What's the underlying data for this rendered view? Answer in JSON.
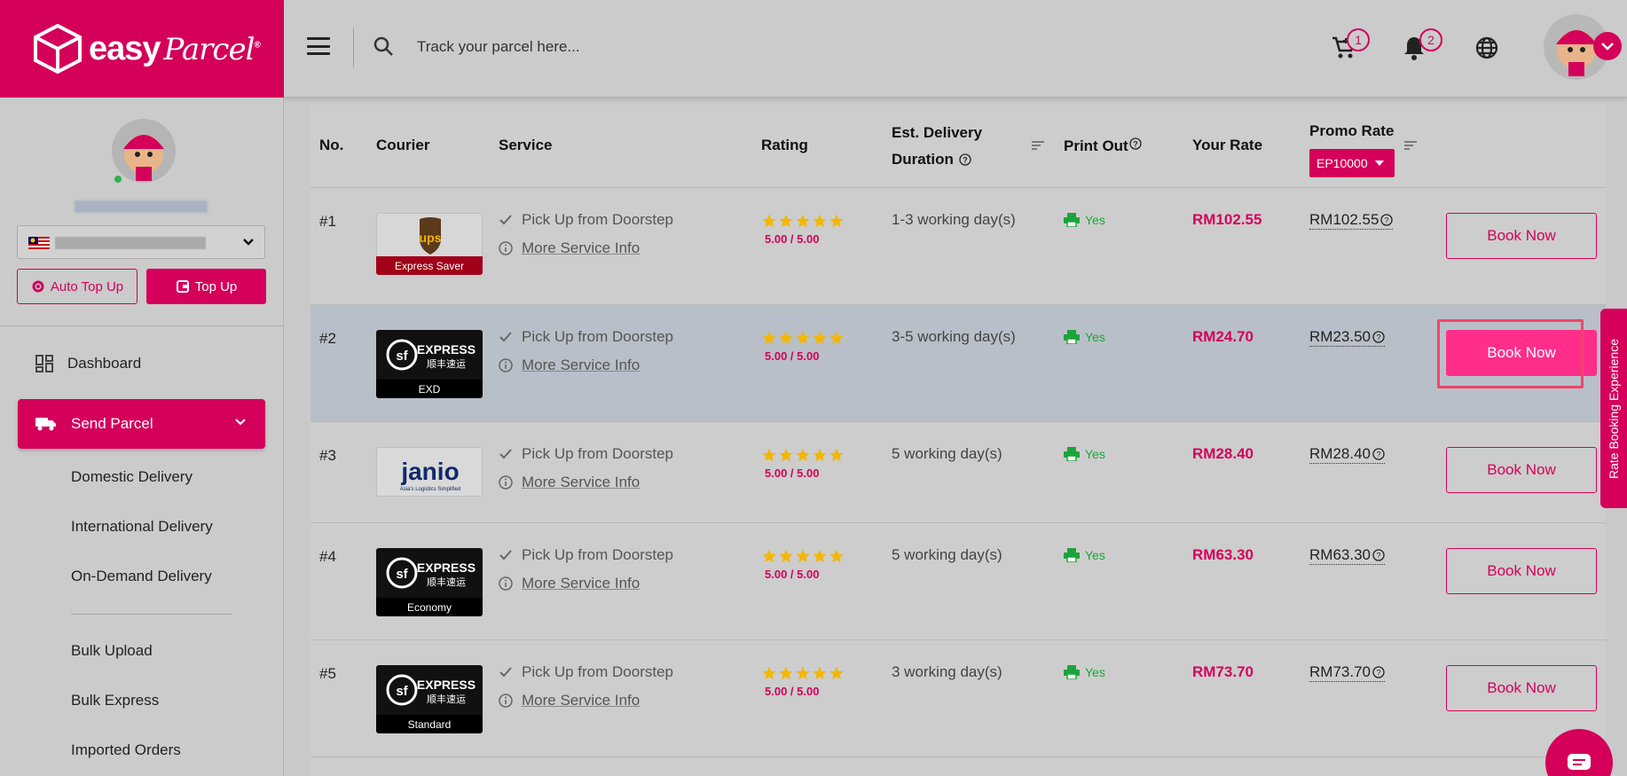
{
  "brand": {
    "name_easy": "easy",
    "name_parcel": "Parcel",
    "registered": "®",
    "color": "#d4005a"
  },
  "header": {
    "search_placeholder": "Track your parcel here...",
    "cart_count": "1",
    "notification_count": "2"
  },
  "sidebar": {
    "auto_topup_label": "Auto Top Up",
    "topup_label": "Top Up",
    "nav": {
      "dashboard": "Dashboard",
      "send_parcel": "Send Parcel",
      "sub_items": [
        "Domestic Delivery",
        "International Delivery",
        "On-Demand Delivery",
        "Bulk Upload",
        "Bulk Express",
        "Imported Orders"
      ]
    }
  },
  "table": {
    "headers": {
      "no": "No.",
      "courier": "Courier",
      "service": "Service",
      "rating": "Rating",
      "duration_line1": "Est. Delivery",
      "duration_line2": "Duration",
      "print_out": "Print Out",
      "your_rate": "Your Rate",
      "promo_rate": "Promo Rate"
    },
    "promo_code": "EP10000",
    "service_pickup": "Pick Up from Doorstep",
    "service_more": "More Service Info",
    "print_yes": "Yes",
    "book_label": "Book Now",
    "rows": [
      {
        "no": "#1",
        "courier": "ups",
        "tag": "Express Saver",
        "score": "5.00 / 5.00",
        "stars": 5,
        "duration": "1-3 working day(s)",
        "rate": "RM102.55",
        "promo": "RM102.55"
      },
      {
        "no": "#2",
        "courier": "sf-express",
        "tag": "EXD",
        "score": "5.00 / 5.00",
        "stars": 5,
        "duration": "3-5 working day(s)",
        "rate": "RM24.70",
        "promo": "RM23.50"
      },
      {
        "no": "#3",
        "courier": "janio",
        "tag": "",
        "score": "5.00 / 5.00",
        "stars": 5,
        "duration": "5 working day(s)",
        "rate": "RM28.40",
        "promo": "RM28.40"
      },
      {
        "no": "#4",
        "courier": "sf-express",
        "tag": "Economy",
        "score": "5.00 / 5.00",
        "stars": 5,
        "duration": "5 working day(s)",
        "rate": "RM63.30",
        "promo": "RM63.30"
      },
      {
        "no": "#5",
        "courier": "sf-express",
        "tag": "Standard",
        "score": "5.00 / 5.00",
        "stars": 5,
        "duration": "3 working day(s)",
        "rate": "RM73.70",
        "promo": "RM73.70"
      }
    ]
  },
  "logos": {
    "ups": "ups",
    "sf_express": "EXPRESS",
    "sf_chinese": "顺丰速运",
    "janio": "janio",
    "janio_sub": "Asia's Logistics Simplified"
  },
  "feedback_tab": "Rate Booking Experience"
}
